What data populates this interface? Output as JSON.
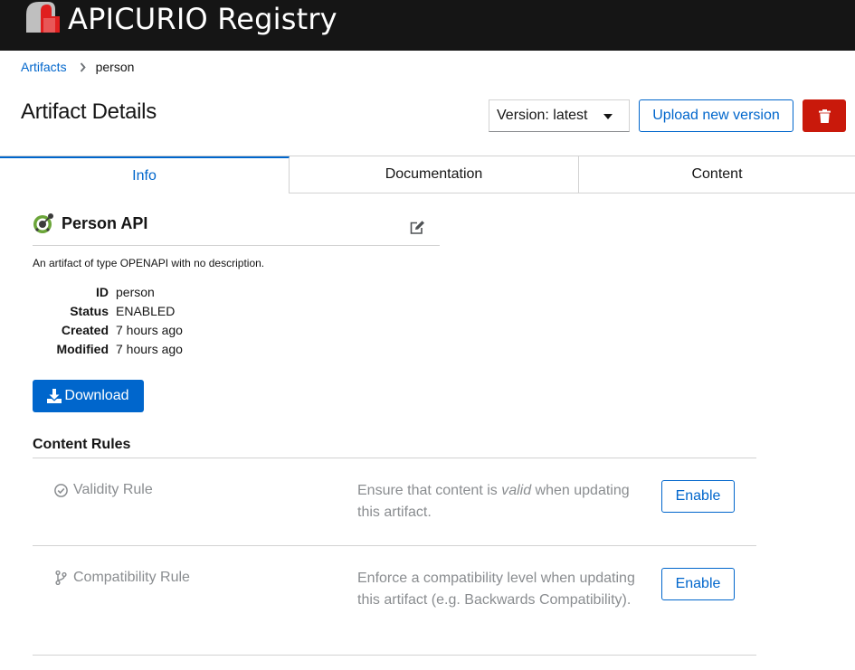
{
  "masthead": {
    "brand": "APICURIO Registry",
    "logo_icon": "apicurio-logo-icon"
  },
  "breadcrumb": {
    "root": "Artifacts",
    "separator_icon": "chevron-right-icon",
    "current": "person"
  },
  "page": {
    "title": "Artifact Details"
  },
  "toolbar": {
    "version_value": "Version: latest",
    "upload_label": "Upload new version",
    "delete_icon": "trash-icon",
    "delete_color": "#c9190b"
  },
  "tabs": [
    {
      "label": "Info",
      "active": true
    },
    {
      "label": "Documentation",
      "active": false
    },
    {
      "label": "Content",
      "active": false
    }
  ],
  "artifact": {
    "name": "Person API",
    "type_icon": "openapi-icon",
    "description": "An artifact of type OPENAPI with no description.",
    "properties": [
      {
        "label": "ID",
        "value": "person"
      },
      {
        "label": "Status",
        "value": "ENABLED"
      },
      {
        "label": "Created",
        "value": "7 hours ago"
      },
      {
        "label": "Modified",
        "value": "7 hours ago"
      }
    ],
    "download_label": "Download"
  },
  "rules": {
    "title": "Content Rules",
    "items": [
      {
        "name": "Validity Rule",
        "icon": "check-circle-icon",
        "desc_before": "Ensure that content is ",
        "desc_em": "valid",
        "desc_after": " when updating this artifact.",
        "action": "Enable"
      },
      {
        "name": "Compatibility Rule",
        "icon": "code-branch-icon",
        "desc": "Enforce a compatibility level when updating this artifact (e.g. Backwards Compatibility).",
        "action": "Enable"
      }
    ]
  },
  "colors": {
    "accent": "#0066cc",
    "masthead": "#151515",
    "danger": "#c9190b",
    "muted": "#8a8d90"
  }
}
